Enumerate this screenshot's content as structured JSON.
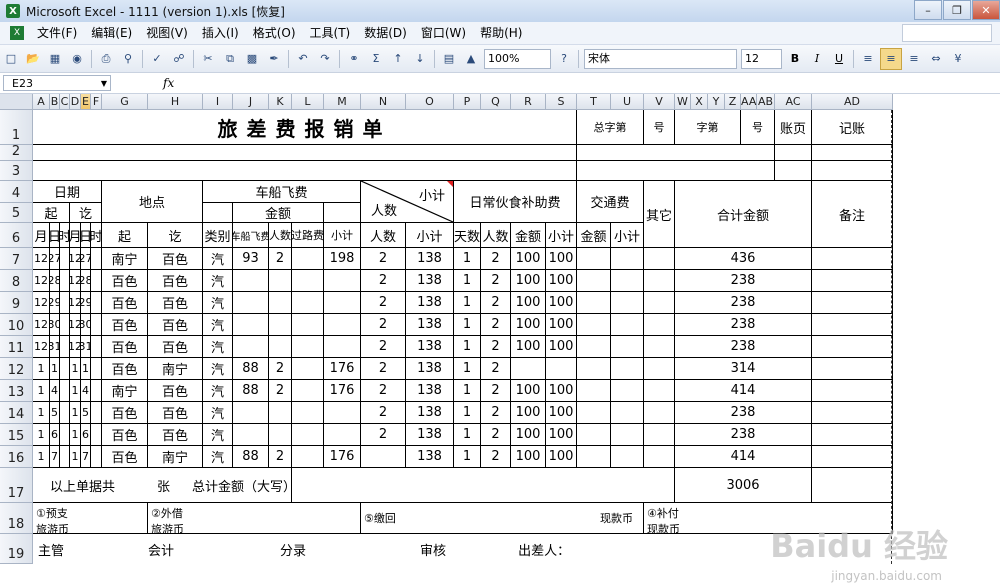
{
  "window": {
    "title": "Microsoft Excel - 1111 (version 1).xls  [恢复]",
    "app_icon": "excel-icon"
  },
  "menubar": {
    "items": [
      "文件(F)",
      "编辑(E)",
      "视图(V)",
      "插入(I)",
      "格式(O)",
      "工具(T)",
      "数据(D)",
      "窗口(W)",
      "帮助(H)"
    ]
  },
  "toolbar": {
    "zoom": "100%",
    "font": "宋体",
    "font_size": "12",
    "bold": "B",
    "italic": "I",
    "underline": "U"
  },
  "formula_bar": {
    "name_box": "E23",
    "fx": "fx"
  },
  "columns": [
    "A",
    "B",
    "C",
    "D",
    "E",
    "F",
    "G",
    "H",
    "I",
    "J",
    "K",
    "L",
    "M",
    "N",
    "O",
    "P",
    "Q",
    "R",
    "S",
    "T",
    "U",
    "V",
    "W",
    "X",
    "Y",
    "Z",
    "AA",
    "AB",
    "AC",
    "AD"
  ],
  "selected_column": "E",
  "rows": [
    "1",
    "2",
    "3",
    "4",
    "5",
    "6",
    "7",
    "8",
    "9",
    "10",
    "11",
    "12",
    "13",
    "14",
    "15",
    "16",
    "17",
    "18",
    "19"
  ],
  "sheet": {
    "title": "旅差费报销单",
    "zongzi": "总字第",
    "hao1": "号",
    "zi": "字第",
    "hao2": "号",
    "zhangye": "账页",
    "jizhang": "记账",
    "riqi": "日期",
    "qi": "起",
    "qi2": "讫",
    "didian": "地点",
    "chechuan": "车船飞费",
    "jine": "金额",
    "xiaoji_top": "小计",
    "renshu_top": "人数",
    "richang": "日常伙食补助费",
    "jiaotong": "交通费",
    "qita": "其它",
    "heji": "合计金额",
    "beizhu": "备注",
    "h6": [
      "月",
      "日",
      "时",
      "月",
      "日",
      "时",
      "起",
      "讫",
      "类别",
      "车船飞费",
      "人数",
      "过路费",
      "小计",
      "人数",
      "小计",
      "天数",
      "人数",
      "金额",
      "小计",
      "金额",
      "小计"
    ],
    "data": [
      [
        "12",
        "27",
        "",
        "12",
        "27",
        "",
        "南宁",
        "百色",
        "汽",
        "93",
        "2",
        "",
        "198",
        "2",
        "138",
        "1",
        "2",
        "100",
        "100",
        "",
        "",
        "",
        "436"
      ],
      [
        "12",
        "28",
        "",
        "12",
        "28",
        "",
        "百色",
        "百色",
        "汽",
        "",
        "",
        "",
        "",
        "2",
        "138",
        "1",
        "2",
        "100",
        "100",
        "",
        "",
        "",
        "238"
      ],
      [
        "12",
        "29",
        "",
        "12",
        "29",
        "",
        "百色",
        "百色",
        "汽",
        "",
        "",
        "",
        "",
        "2",
        "138",
        "1",
        "2",
        "100",
        "100",
        "",
        "",
        "",
        "238"
      ],
      [
        "12",
        "30",
        "",
        "12",
        "30",
        "",
        "百色",
        "百色",
        "汽",
        "",
        "",
        "",
        "",
        "2",
        "138",
        "1",
        "2",
        "100",
        "100",
        "",
        "",
        "",
        "238"
      ],
      [
        "12",
        "31",
        "",
        "12",
        "31",
        "",
        "百色",
        "百色",
        "汽",
        "",
        "",
        "",
        "",
        "2",
        "138",
        "1",
        "2",
        "100",
        "100",
        "",
        "",
        "",
        "238"
      ],
      [
        "1",
        "1",
        "",
        "1",
        "1",
        "",
        "百色",
        "南宁",
        "汽",
        "88",
        "2",
        "",
        "176",
        "2",
        "138",
        "1",
        "2",
        "",
        "",
        "",
        "",
        "",
        "314"
      ],
      [
        "1",
        "4",
        "",
        "1",
        "4",
        "",
        "南宁",
        "百色",
        "汽",
        "88",
        "2",
        "",
        "176",
        "2",
        "138",
        "1",
        "2",
        "100",
        "100",
        "",
        "",
        "",
        "414"
      ],
      [
        "1",
        "5",
        "",
        "1",
        "5",
        "",
        "百色",
        "百色",
        "汽",
        "",
        "",
        "",
        "",
        "2",
        "138",
        "1",
        "2",
        "100",
        "100",
        "",
        "",
        "",
        "238"
      ],
      [
        "1",
        "6",
        "",
        "1",
        "6",
        "",
        "百色",
        "百色",
        "汽",
        "",
        "",
        "",
        "",
        "2",
        "138",
        "1",
        "2",
        "100",
        "100",
        "",
        "",
        "",
        "238"
      ],
      [
        "1",
        "7",
        "",
        "1",
        "7",
        "",
        "百色",
        "南宁",
        "汽",
        "88",
        "2",
        "",
        "176",
        "",
        "138",
        "1",
        "2",
        "100",
        "100",
        "",
        "",
        "",
        "414"
      ]
    ],
    "r17_label": "以上单据共",
    "r17_zhang": "张",
    "r17_total_label": "总计金额（大写）",
    "r17_total": "3006",
    "r18_yuzhi": "①预支",
    "r18_lvyoubi1": "旅游币",
    "r18_waijie": "②外借",
    "r18_lvyoubi2": "旅游币",
    "r18_jiaohui": "⑤缴回",
    "r18_xiankuanbi1": "现款币",
    "r18_bufu": "④补付",
    "r18_xiankuanbi2": "现款币",
    "r19_zhuguan": "主管",
    "r19_kuaiji": "会计",
    "r19_fenlu": "分录",
    "r19_shenhe": "审核",
    "r19_chuchairen": "出差人："
  },
  "watermark": {
    "brand": "Baidu 经验",
    "url": "jingyan.baidu.com"
  }
}
